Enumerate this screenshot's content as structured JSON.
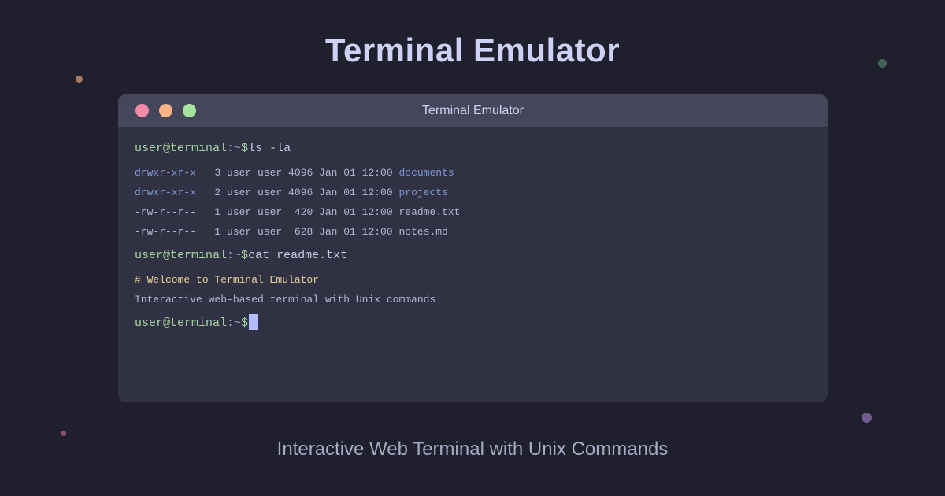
{
  "page": {
    "title": "Terminal Emulator",
    "subtitle": "Interactive Web Terminal with Unix Commands"
  },
  "window": {
    "title": "Terminal Emulator",
    "controls": [
      "close",
      "minimize",
      "maximize"
    ]
  },
  "prompt": {
    "user_host": "user@terminal",
    "path": ":~",
    "symbol": "$"
  },
  "session": {
    "cmd1": "ls -la",
    "listing": [
      {
        "perms": "drwxr-xr-x",
        "rest": "   3 user user 4096 Jan 01 12:00 ",
        "name": "documents",
        "is_dir": true
      },
      {
        "perms": "drwxr-xr-x",
        "rest": "   2 user user 4096 Jan 01 12:00 ",
        "name": "projects",
        "is_dir": true
      },
      {
        "perms": "-rw-r--r--",
        "rest": "   1 user user  420 Jan 01 12:00 ",
        "name": "readme.txt",
        "is_dir": false
      },
      {
        "perms": "-rw-r--r--",
        "rest": "   1 user user  628 Jan 01 12:00 ",
        "name": "notes.md",
        "is_dir": false
      }
    ],
    "cmd2": "cat readme.txt",
    "file_heading": "# Welcome to Terminal Emulator",
    "file_body": "Interactive web-based terminal with Unix commands",
    "cmd3": ""
  },
  "colors": {
    "background": "#1f1f2e",
    "window": "#303143",
    "titlebar": "#45465a",
    "prompt": "#a6d6a0",
    "directory": "#7f99d6",
    "heading": "#e8cf96",
    "cursor": "#b4befe",
    "close": "#f38ba8",
    "minimize": "#fab387",
    "maximize": "#a6e3a1"
  }
}
